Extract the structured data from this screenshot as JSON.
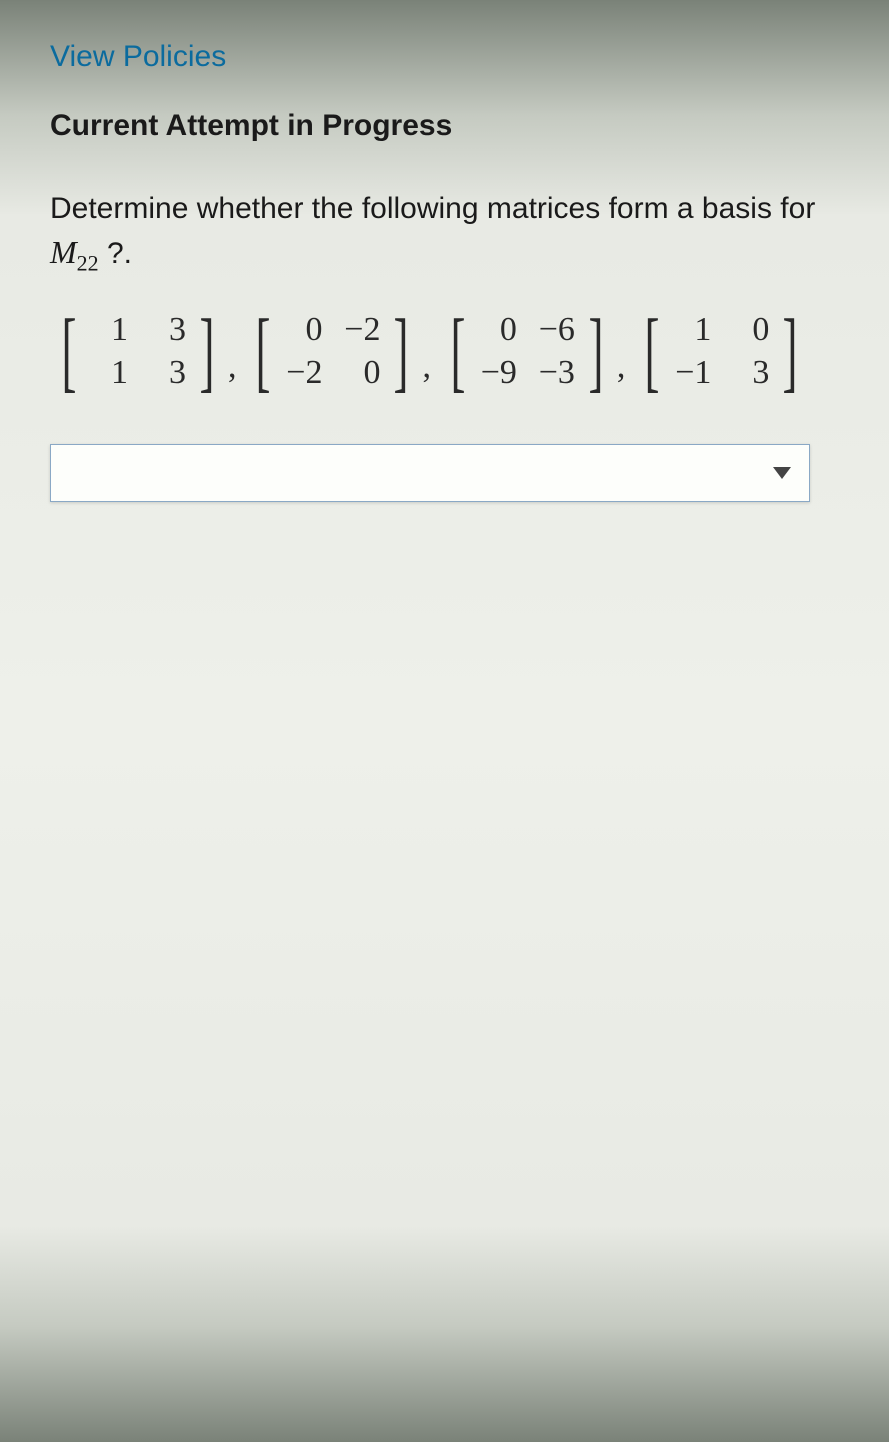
{
  "links": {
    "view_policies": "View Policies"
  },
  "status": {
    "attempt": "Current Attempt in Progress"
  },
  "question": {
    "prefix": "Determine whether the following matrices form a basis for ",
    "space_symbol_M": "M",
    "space_symbol_sub": "22",
    "suffix": " ?."
  },
  "matrices": [
    {
      "rows": [
        [
          "1",
          "3"
        ],
        [
          "1",
          "3"
        ]
      ]
    },
    {
      "rows": [
        [
          "0",
          "−2"
        ],
        [
          "−2",
          "0"
        ]
      ]
    },
    {
      "rows": [
        [
          "0",
          "−6"
        ],
        [
          "−9",
          "−3"
        ]
      ]
    },
    {
      "rows": [
        [
          "1",
          "0"
        ],
        [
          "−1",
          "3"
        ]
      ]
    }
  ],
  "answer": {
    "value": ""
  }
}
